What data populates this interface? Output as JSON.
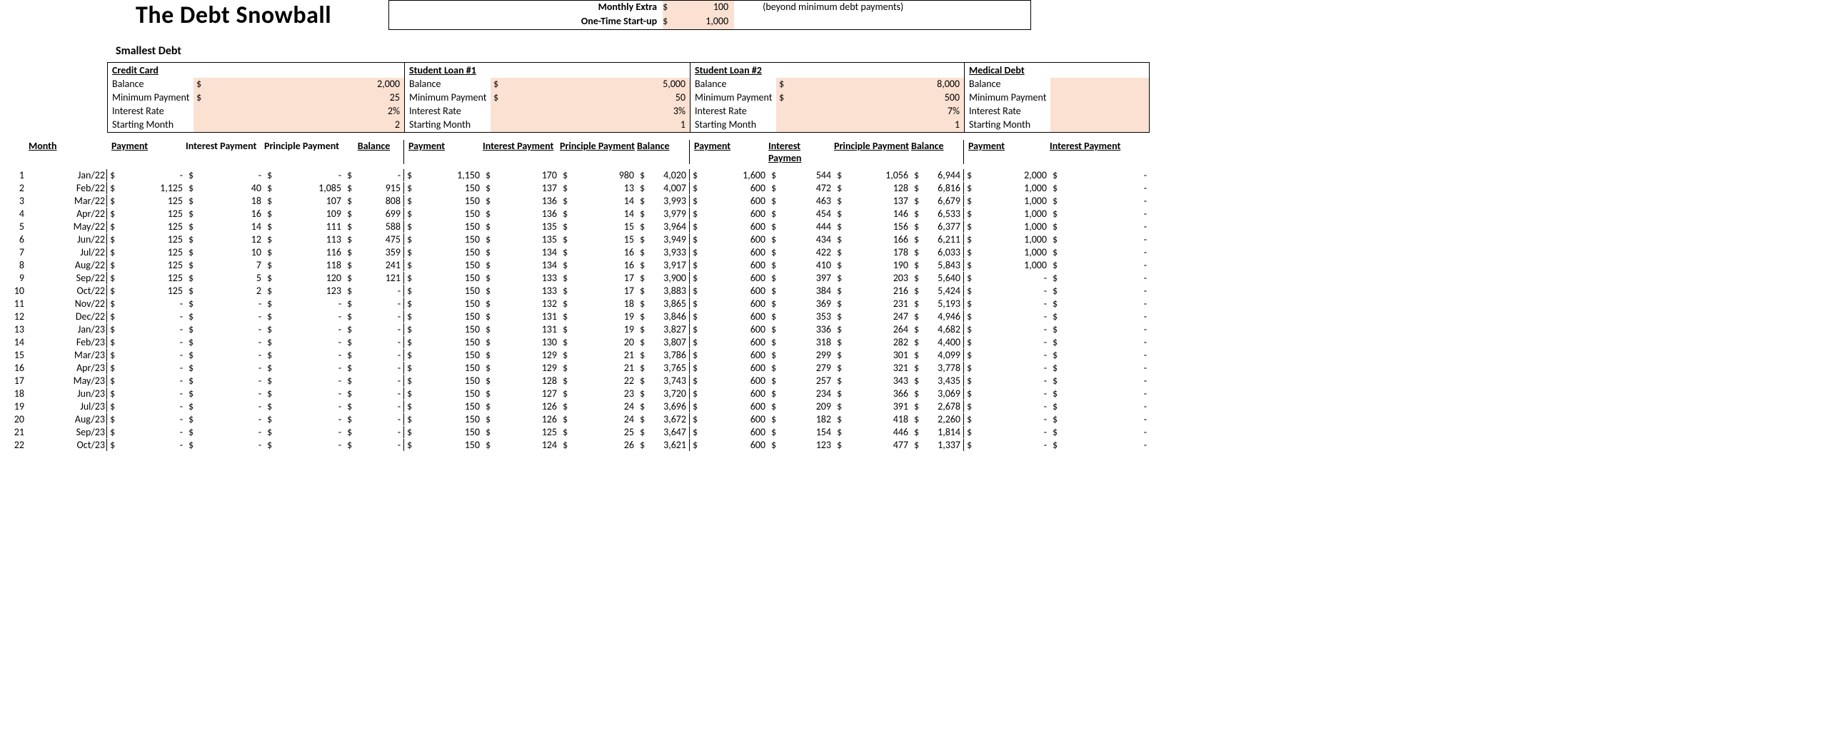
{
  "title": "The Debt Snowball",
  "extras_box": {
    "monthly_extra_label": "Monthly Extra",
    "monthly_extra_value": "100",
    "one_time_label": "One-Time Start-up",
    "one_time_value": "1,000",
    "note": "(beyond minimum debt payments)"
  },
  "smallest_debt_label": "Smallest Debt",
  "field_labels": {
    "balance": "Balance",
    "min_payment": "Minimum Payment",
    "interest_rate": "Interest Rate",
    "starting_month": "Starting Month"
  },
  "col_headers": {
    "month": "Month",
    "payment": "Payment",
    "interest_payment": "Interest Payment",
    "interest_paymen": "Interest Paymen",
    "principle_payment": "Principle Payment",
    "balance": "Balance"
  },
  "debts": [
    {
      "name": "Credit Card",
      "balance": "2,000",
      "min_payment": "25",
      "interest_rate": "2%",
      "starting_month": "2"
    },
    {
      "name": "Student Loan #1",
      "balance": "5,000",
      "min_payment": "50",
      "interest_rate": "3%",
      "starting_month": "1"
    },
    {
      "name": "Student Loan #2",
      "balance": "8,000",
      "min_payment": "500",
      "interest_rate": "7%",
      "starting_month": "1"
    },
    {
      "name": "Medical Debt",
      "balance": "",
      "min_payment": "",
      "interest_rate": "",
      "starting_month": ""
    }
  ],
  "rows": [
    {
      "i": "1",
      "m": "Jan/22",
      "cc": {
        "p": "-",
        "in": "-",
        "pr": "-",
        "b": "-"
      },
      "s1": {
        "p": "1,150",
        "in": "170",
        "pr": "980",
        "b": "4,020"
      },
      "s2": {
        "p": "1,600",
        "in": "544",
        "pr": "1,056",
        "b": "6,944"
      },
      "md": {
        "p": "2,000",
        "in": "-"
      }
    },
    {
      "i": "2",
      "m": "Feb/22",
      "cc": {
        "p": "1,125",
        "in": "40",
        "pr": "1,085",
        "b": "915"
      },
      "s1": {
        "p": "150",
        "in": "137",
        "pr": "13",
        "b": "4,007"
      },
      "s2": {
        "p": "600",
        "in": "472",
        "pr": "128",
        "b": "6,816"
      },
      "md": {
        "p": "1,000",
        "in": "-"
      }
    },
    {
      "i": "3",
      "m": "Mar/22",
      "cc": {
        "p": "125",
        "in": "18",
        "pr": "107",
        "b": "808"
      },
      "s1": {
        "p": "150",
        "in": "136",
        "pr": "14",
        "b": "3,993"
      },
      "s2": {
        "p": "600",
        "in": "463",
        "pr": "137",
        "b": "6,679"
      },
      "md": {
        "p": "1,000",
        "in": "-"
      }
    },
    {
      "i": "4",
      "m": "Apr/22",
      "cc": {
        "p": "125",
        "in": "16",
        "pr": "109",
        "b": "699"
      },
      "s1": {
        "p": "150",
        "in": "136",
        "pr": "14",
        "b": "3,979"
      },
      "s2": {
        "p": "600",
        "in": "454",
        "pr": "146",
        "b": "6,533"
      },
      "md": {
        "p": "1,000",
        "in": "-"
      }
    },
    {
      "i": "5",
      "m": "May/22",
      "cc": {
        "p": "125",
        "in": "14",
        "pr": "111",
        "b": "588"
      },
      "s1": {
        "p": "150",
        "in": "135",
        "pr": "15",
        "b": "3,964"
      },
      "s2": {
        "p": "600",
        "in": "444",
        "pr": "156",
        "b": "6,377"
      },
      "md": {
        "p": "1,000",
        "in": "-"
      }
    },
    {
      "i": "6",
      "m": "Jun/22",
      "cc": {
        "p": "125",
        "in": "12",
        "pr": "113",
        "b": "475"
      },
      "s1": {
        "p": "150",
        "in": "135",
        "pr": "15",
        "b": "3,949"
      },
      "s2": {
        "p": "600",
        "in": "434",
        "pr": "166",
        "b": "6,211"
      },
      "md": {
        "p": "1,000",
        "in": "-"
      }
    },
    {
      "i": "7",
      "m": "Jul/22",
      "cc": {
        "p": "125",
        "in": "10",
        "pr": "116",
        "b": "359"
      },
      "s1": {
        "p": "150",
        "in": "134",
        "pr": "16",
        "b": "3,933"
      },
      "s2": {
        "p": "600",
        "in": "422",
        "pr": "178",
        "b": "6,033"
      },
      "md": {
        "p": "1,000",
        "in": "-"
      }
    },
    {
      "i": "8",
      "m": "Aug/22",
      "cc": {
        "p": "125",
        "in": "7",
        "pr": "118",
        "b": "241"
      },
      "s1": {
        "p": "150",
        "in": "134",
        "pr": "16",
        "b": "3,917"
      },
      "s2": {
        "p": "600",
        "in": "410",
        "pr": "190",
        "b": "5,843"
      },
      "md": {
        "p": "1,000",
        "in": "-"
      }
    },
    {
      "i": "9",
      "m": "Sep/22",
      "cc": {
        "p": "125",
        "in": "5",
        "pr": "120",
        "b": "121"
      },
      "s1": {
        "p": "150",
        "in": "133",
        "pr": "17",
        "b": "3,900"
      },
      "s2": {
        "p": "600",
        "in": "397",
        "pr": "203",
        "b": "5,640"
      },
      "md": {
        "p": "-",
        "in": "-"
      }
    },
    {
      "i": "10",
      "m": "Oct/22",
      "cc": {
        "p": "125",
        "in": "2",
        "pr": "123",
        "b": "-"
      },
      "s1": {
        "p": "150",
        "in": "133",
        "pr": "17",
        "b": "3,883"
      },
      "s2": {
        "p": "600",
        "in": "384",
        "pr": "216",
        "b": "5,424"
      },
      "md": {
        "p": "-",
        "in": "-"
      }
    },
    {
      "i": "11",
      "m": "Nov/22",
      "cc": {
        "p": "-",
        "in": "-",
        "pr": "-",
        "b": "-"
      },
      "s1": {
        "p": "150",
        "in": "132",
        "pr": "18",
        "b": "3,865"
      },
      "s2": {
        "p": "600",
        "in": "369",
        "pr": "231",
        "b": "5,193"
      },
      "md": {
        "p": "-",
        "in": "-"
      }
    },
    {
      "i": "12",
      "m": "Dec/22",
      "cc": {
        "p": "-",
        "in": "-",
        "pr": "-",
        "b": "-"
      },
      "s1": {
        "p": "150",
        "in": "131",
        "pr": "19",
        "b": "3,846"
      },
      "s2": {
        "p": "600",
        "in": "353",
        "pr": "247",
        "b": "4,946"
      },
      "md": {
        "p": "-",
        "in": "-"
      }
    },
    {
      "i": "13",
      "m": "Jan/23",
      "cc": {
        "p": "-",
        "in": "-",
        "pr": "-",
        "b": "-"
      },
      "s1": {
        "p": "150",
        "in": "131",
        "pr": "19",
        "b": "3,827"
      },
      "s2": {
        "p": "600",
        "in": "336",
        "pr": "264",
        "b": "4,682"
      },
      "md": {
        "p": "-",
        "in": "-"
      }
    },
    {
      "i": "14",
      "m": "Feb/23",
      "cc": {
        "p": "-",
        "in": "-",
        "pr": "-",
        "b": "-"
      },
      "s1": {
        "p": "150",
        "in": "130",
        "pr": "20",
        "b": "3,807"
      },
      "s2": {
        "p": "600",
        "in": "318",
        "pr": "282",
        "b": "4,400"
      },
      "md": {
        "p": "-",
        "in": "-"
      }
    },
    {
      "i": "15",
      "m": "Mar/23",
      "cc": {
        "p": "-",
        "in": "-",
        "pr": "-",
        "b": "-"
      },
      "s1": {
        "p": "150",
        "in": "129",
        "pr": "21",
        "b": "3,786"
      },
      "s2": {
        "p": "600",
        "in": "299",
        "pr": "301",
        "b": "4,099"
      },
      "md": {
        "p": "-",
        "in": "-"
      }
    },
    {
      "i": "16",
      "m": "Apr/23",
      "cc": {
        "p": "-",
        "in": "-",
        "pr": "-",
        "b": "-"
      },
      "s1": {
        "p": "150",
        "in": "129",
        "pr": "21",
        "b": "3,765"
      },
      "s2": {
        "p": "600",
        "in": "279",
        "pr": "321",
        "b": "3,778"
      },
      "md": {
        "p": "-",
        "in": "-"
      }
    },
    {
      "i": "17",
      "m": "May/23",
      "cc": {
        "p": "-",
        "in": "-",
        "pr": "-",
        "b": "-"
      },
      "s1": {
        "p": "150",
        "in": "128",
        "pr": "22",
        "b": "3,743"
      },
      "s2": {
        "p": "600",
        "in": "257",
        "pr": "343",
        "b": "3,435"
      },
      "md": {
        "p": "-",
        "in": "-"
      }
    },
    {
      "i": "18",
      "m": "Jun/23",
      "cc": {
        "p": "-",
        "in": "-",
        "pr": "-",
        "b": "-"
      },
      "s1": {
        "p": "150",
        "in": "127",
        "pr": "23",
        "b": "3,720"
      },
      "s2": {
        "p": "600",
        "in": "234",
        "pr": "366",
        "b": "3,069"
      },
      "md": {
        "p": "-",
        "in": "-"
      }
    },
    {
      "i": "19",
      "m": "Jul/23",
      "cc": {
        "p": "-",
        "in": "-",
        "pr": "-",
        "b": "-"
      },
      "s1": {
        "p": "150",
        "in": "126",
        "pr": "24",
        "b": "3,696"
      },
      "s2": {
        "p": "600",
        "in": "209",
        "pr": "391",
        "b": "2,678"
      },
      "md": {
        "p": "-",
        "in": "-"
      }
    },
    {
      "i": "20",
      "m": "Aug/23",
      "cc": {
        "p": "-",
        "in": "-",
        "pr": "-",
        "b": "-"
      },
      "s1": {
        "p": "150",
        "in": "126",
        "pr": "24",
        "b": "3,672"
      },
      "s2": {
        "p": "600",
        "in": "182",
        "pr": "418",
        "b": "2,260"
      },
      "md": {
        "p": "-",
        "in": "-"
      }
    },
    {
      "i": "21",
      "m": "Sep/23",
      "cc": {
        "p": "-",
        "in": "-",
        "pr": "-",
        "b": "-"
      },
      "s1": {
        "p": "150",
        "in": "125",
        "pr": "25",
        "b": "3,647"
      },
      "s2": {
        "p": "600",
        "in": "154",
        "pr": "446",
        "b": "1,814"
      },
      "md": {
        "p": "-",
        "in": "-"
      }
    },
    {
      "i": "22",
      "m": "Oct/23",
      "cc": {
        "p": "-",
        "in": "-",
        "pr": "-",
        "b": "-"
      },
      "s1": {
        "p": "150",
        "in": "124",
        "pr": "26",
        "b": "3,621"
      },
      "s2": {
        "p": "600",
        "in": "123",
        "pr": "477",
        "b": "1,337"
      },
      "md": {
        "p": "-",
        "in": "-"
      }
    }
  ]
}
